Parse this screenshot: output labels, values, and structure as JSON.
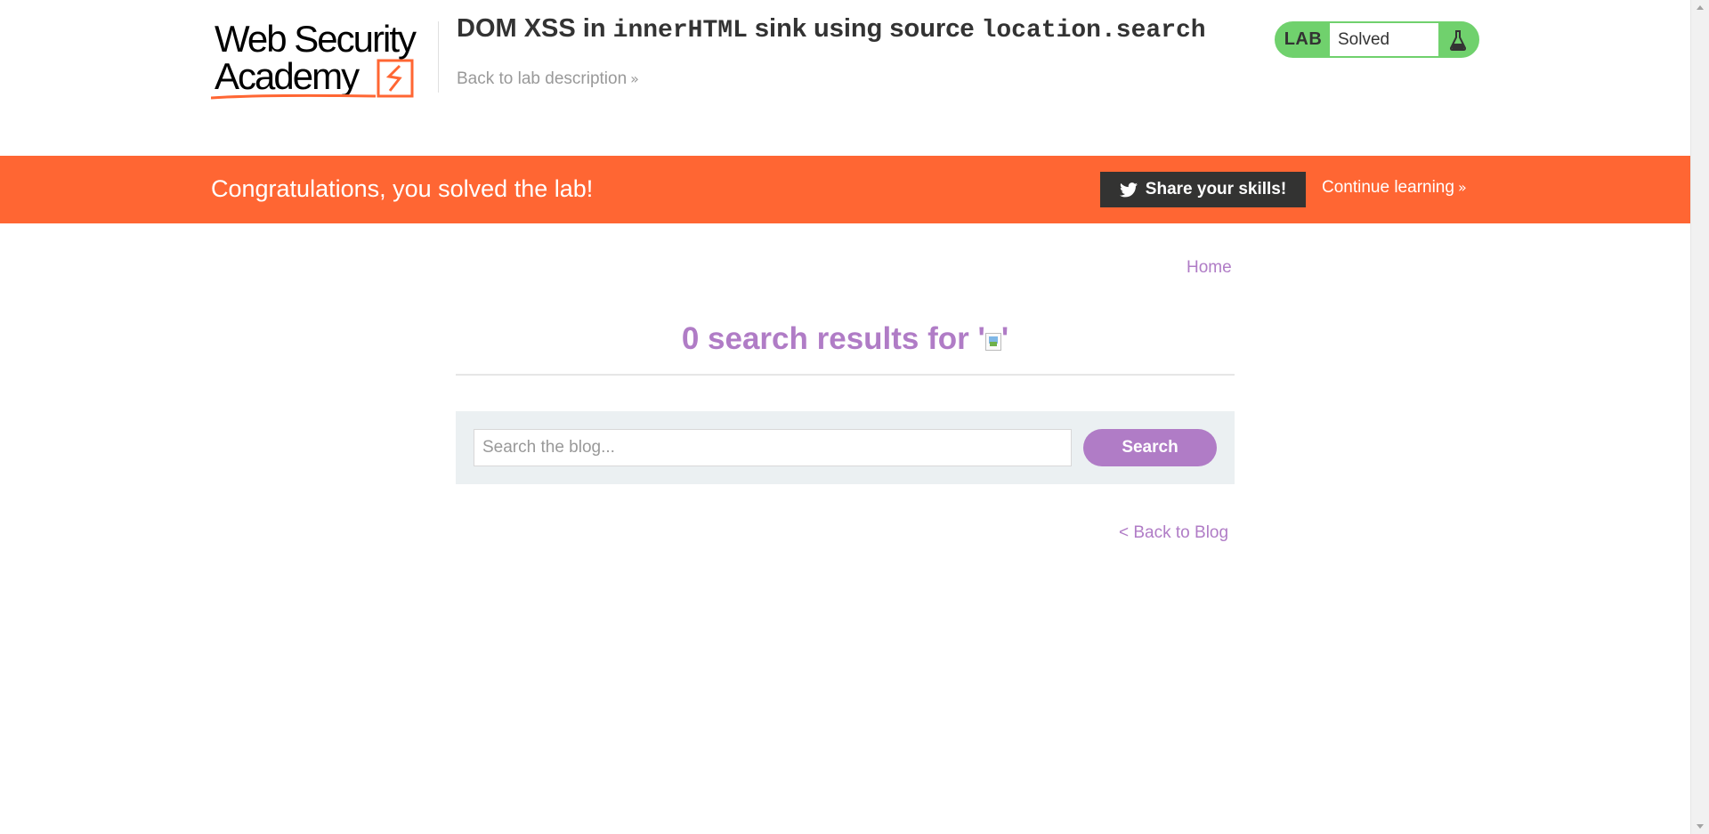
{
  "header": {
    "logo_line1": "Web Security",
    "logo_line2": "Academy",
    "lab_title_prefix": "DOM XSS in ",
    "lab_title_code1": "innerHTML",
    "lab_title_mid": " sink using source ",
    "lab_title_code2": "location.search",
    "back_to_description": "Back to lab description",
    "status_tag": "LAB",
    "status_text": "Solved"
  },
  "banner": {
    "message": "Congratulations, you solved the lab!",
    "share_label": "Share your skills!",
    "continue_label": "Continue learning"
  },
  "main": {
    "home_link": "Home",
    "results_count": "0",
    "results_prefix": " search results for '",
    "results_suffix": "'",
    "search_placeholder": "Search the blog...",
    "search_value": "",
    "search_button": "Search",
    "back_to_blog": "< Back to Blog"
  },
  "colors": {
    "brand_orange": "#ff6633",
    "accent_purple": "#b07cc6",
    "status_green": "#70d16d"
  }
}
